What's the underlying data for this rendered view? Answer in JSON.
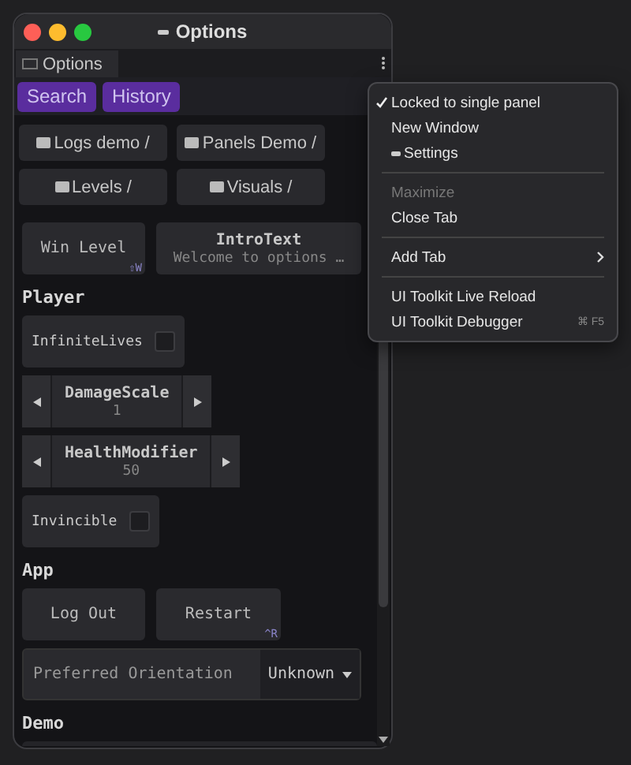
{
  "window": {
    "title": "Options"
  },
  "tabs": [
    {
      "label": "Options",
      "selected": true
    }
  ],
  "toolbar_buttons": [
    "Search",
    "History"
  ],
  "folder_buttons": [
    "Logs demo /",
    "Panels Demo /",
    "Levels /",
    "Visuals /"
  ],
  "sections": [
    {
      "rows": [
        [
          {
            "kind": "button",
            "label": "Win Level",
            "shortcut": "⇧W"
          },
          {
            "kind": "text",
            "label": "IntroText",
            "value": "Welcome to options …"
          }
        ]
      ]
    },
    {
      "heading": "Player",
      "rows": [
        [
          {
            "kind": "checkbox",
            "label": "InfiniteLives",
            "checked": false
          }
        ],
        [
          {
            "kind": "stepper",
            "label": "DamageScale",
            "value": "1"
          }
        ],
        [
          {
            "kind": "stepper",
            "label": "HealthModifier",
            "value": "50"
          }
        ],
        [
          {
            "kind": "checkbox",
            "label": "Invincible",
            "checked": false
          }
        ]
      ]
    },
    {
      "heading": "App",
      "rows": [
        [
          {
            "kind": "button",
            "label": "Log Out"
          },
          {
            "kind": "button",
            "label": "Restart",
            "shortcut": "^R"
          }
        ],
        [
          {
            "kind": "dropdown",
            "label": "Preferred Orientation",
            "value": "Unknown"
          }
        ]
      ]
    },
    {
      "heading": "Demo"
    }
  ],
  "menu": [
    {
      "kind": "item",
      "label": "Locked to single panel",
      "checked": true
    },
    {
      "kind": "item",
      "label": "New Window",
      "checked": false
    },
    {
      "kind": "item",
      "label": "Settings",
      "checked": false,
      "icon": true
    },
    {
      "kind": "separator"
    },
    {
      "kind": "item",
      "label": "Maximize",
      "checked": false,
      "disabled": true
    },
    {
      "kind": "item",
      "label": "Close Tab",
      "checked": false
    },
    {
      "kind": "separator"
    },
    {
      "kind": "item",
      "label": "Add Tab",
      "checked": false,
      "submenu": true
    },
    {
      "kind": "separator"
    },
    {
      "kind": "item",
      "label": "UI Toolkit Live Reload",
      "checked": false
    },
    {
      "kind": "item",
      "label": "UI Toolkit Debugger",
      "checked": false,
      "shortcut": "⌘ F5"
    }
  ]
}
